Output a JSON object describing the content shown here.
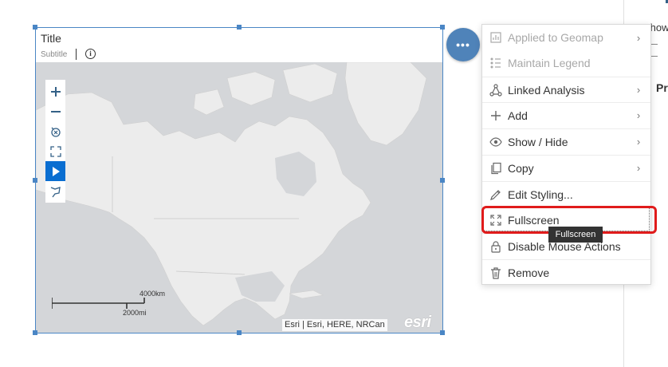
{
  "side_panel": {
    "show_label": "Show",
    "pr_label": "Pr"
  },
  "widget": {
    "title": "Title",
    "subtitle": "Subtitle",
    "info_icon": "info-icon"
  },
  "map": {
    "toolbar": [
      {
        "name": "zoom-in-icon",
        "glyph": "+"
      },
      {
        "name": "zoom-out-icon",
        "glyph": "−"
      },
      {
        "name": "reset-extent-icon",
        "glyph": "⟲"
      },
      {
        "name": "full-extent-icon",
        "glyph": "⤢"
      },
      {
        "name": "select-pointer-icon",
        "glyph": "▶"
      },
      {
        "name": "lasso-icon",
        "glyph": "⚑"
      }
    ],
    "scale_km": "4000km",
    "scale_mi": "2000mi",
    "attribution": "Esri | Esri, HERE, NRCan",
    "logo": "esri",
    "land_color": "#ececec",
    "water_color": "#d4d6d9"
  },
  "more_button": {
    "icon": "more-horizontal-icon",
    "label": "•••"
  },
  "menu": {
    "items": [
      {
        "label": "Applied to Geomap",
        "icon": "applied-to-geomap-icon",
        "disabled": true,
        "submenu": true
      },
      {
        "label": "Maintain Legend",
        "icon": "legend-icon",
        "disabled": true,
        "submenu": false
      },
      {
        "label": "Linked Analysis",
        "icon": "linked-analysis-icon",
        "disabled": false,
        "submenu": true
      },
      {
        "label": "Add",
        "icon": "add-icon",
        "disabled": false,
        "submenu": true
      },
      {
        "label": "Show / Hide",
        "icon": "eye-icon",
        "disabled": false,
        "submenu": true
      },
      {
        "label": "Copy",
        "icon": "copy-icon",
        "disabled": false,
        "submenu": true
      },
      {
        "label": "Edit Styling...",
        "icon": "edit-styling-icon",
        "disabled": false,
        "submenu": false
      },
      {
        "label": "Fullscreen",
        "icon": "fullscreen-icon",
        "disabled": false,
        "submenu": false
      },
      {
        "label": "Disable Mouse Actions",
        "icon": "lock-icon",
        "disabled": false,
        "submenu": false
      },
      {
        "label": "Remove",
        "icon": "trash-icon",
        "disabled": false,
        "submenu": false
      }
    ],
    "tooltip": "Fullscreen",
    "highlight_color": "#e01b1b"
  }
}
